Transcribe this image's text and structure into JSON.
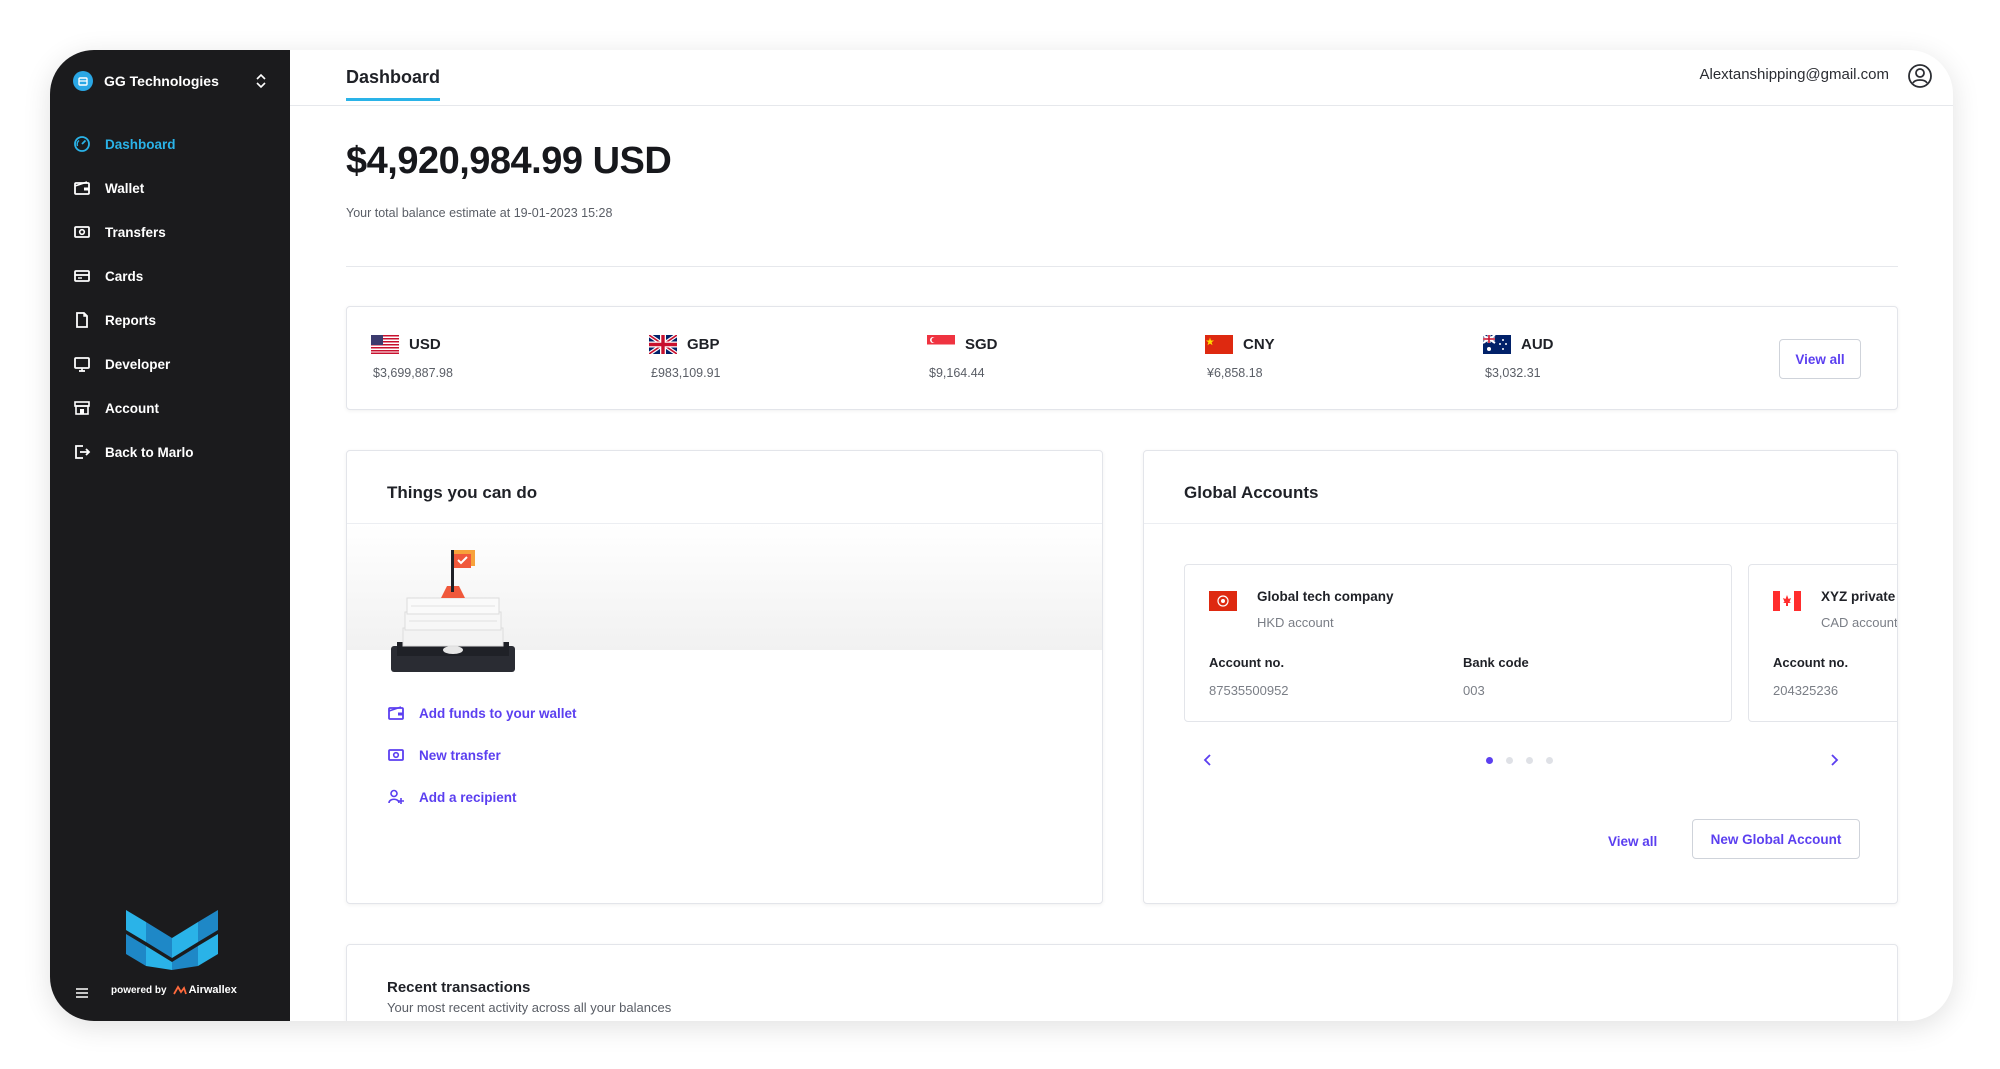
{
  "sidebar": {
    "org_name": "GG Technologies",
    "items": [
      {
        "label": "Dashboard",
        "icon": "dashboard-icon",
        "active": true
      },
      {
        "label": "Wallet",
        "icon": "wallet-icon"
      },
      {
        "label": "Transfers",
        "icon": "transfer-icon"
      },
      {
        "label": "Cards",
        "icon": "card-icon"
      },
      {
        "label": "Reports",
        "icon": "report-icon"
      },
      {
        "label": "Developer",
        "icon": "monitor-icon"
      },
      {
        "label": "Account",
        "icon": "store-icon"
      },
      {
        "label": "Back to Marlo",
        "icon": "exit-icon"
      }
    ],
    "powered_by": "powered by",
    "powered_brand": "Airwallex"
  },
  "header": {
    "tab": "Dashboard",
    "user_email": "Alextanshipping@gmail.com"
  },
  "balance": {
    "total": "$4,920,984.99 USD",
    "subtitle": "Your total balance estimate at 19-01-2023 15:28"
  },
  "currencies": [
    {
      "code": "USD",
      "amount": "$3,699,887.98",
      "flag": "us-flag-icon"
    },
    {
      "code": "GBP",
      "amount": "£983,109.91",
      "flag": "uk-flag-icon"
    },
    {
      "code": "SGD",
      "amount": "$9,164.44",
      "flag": "sg-flag-icon"
    },
    {
      "code": "CNY",
      "amount": "¥6,858.18",
      "flag": "cn-flag-icon"
    },
    {
      "code": "AUD",
      "amount": "$3,032.31",
      "flag": "au-flag-icon"
    }
  ],
  "currencies_view_all": "View all",
  "things": {
    "title": "Things you can do",
    "actions": [
      {
        "label": "Add funds to your wallet",
        "icon": "wallet-icon"
      },
      {
        "label": "New transfer",
        "icon": "transfer-icon"
      },
      {
        "label": "Add a recipient",
        "icon": "add-user-icon"
      }
    ]
  },
  "global_accounts": {
    "title": "Global Accounts",
    "accounts": [
      {
        "name": "Global tech company",
        "type": "HKD account",
        "account_label": "Account no.",
        "account_no": "87535500952",
        "bank_label": "Bank code",
        "bank_code": "003",
        "flag": "hk-flag-icon"
      },
      {
        "name": "XYZ private",
        "type": "CAD account",
        "account_label": "Account no.",
        "account_no": "204325236",
        "flag": "ca-flag-icon"
      }
    ],
    "pages": 4,
    "active_page": 1,
    "view_all": "View all",
    "new_button": "New Global Account"
  },
  "recent": {
    "title": "Recent transactions",
    "subtitle": "Your most recent activity across all your balances"
  },
  "colors": {
    "accent": "#2ab3e8",
    "link": "#5b3ff0",
    "sidebar_bg": "#1b1b1d"
  }
}
